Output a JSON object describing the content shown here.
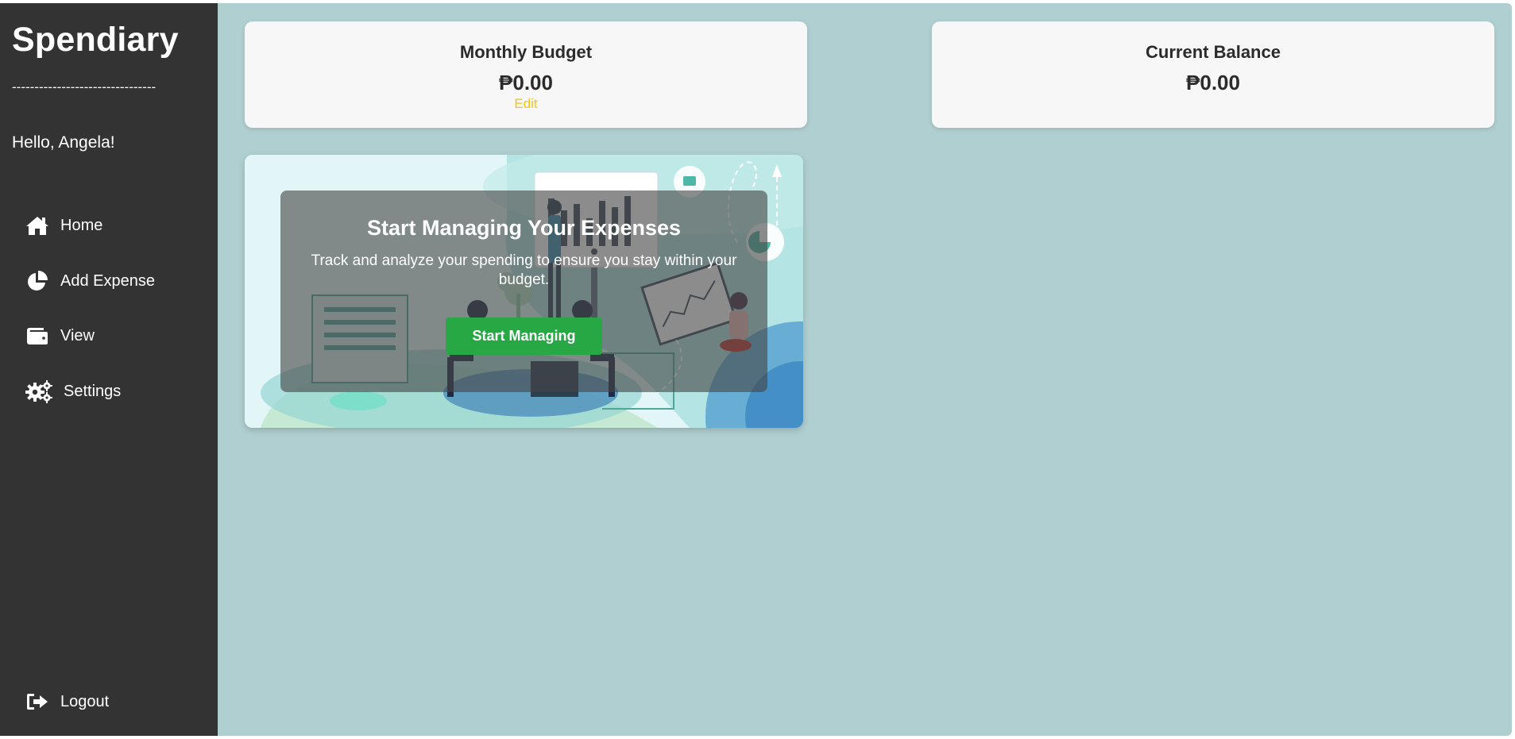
{
  "app": {
    "brand": "Spendiary",
    "divider": "--------------------------------",
    "greeting": "Hello, Angela!"
  },
  "sidebar": {
    "items": [
      {
        "label": "Home",
        "icon": "home-icon"
      },
      {
        "label": "Add Expense",
        "icon": "pie-chart-icon"
      },
      {
        "label": "View",
        "icon": "wallet-icon"
      },
      {
        "label": "Settings",
        "icon": "gears-icon"
      }
    ],
    "logout": {
      "label": "Logout",
      "icon": "sign-out-icon"
    }
  },
  "budget": {
    "title": "Monthly Budget",
    "value": "₱0.00",
    "edit_label": "Edit"
  },
  "balance": {
    "title": "Current Balance",
    "value": "₱0.00"
  },
  "hero": {
    "title": "Start Managing Your Expenses",
    "text": "Track and analyze your spending to ensure you stay within your budget.",
    "button_label": "Start Managing"
  },
  "colors": {
    "sidebar_bg": "#333333",
    "main_bg": "#b0cfd0",
    "card_bg": "#f7f7f7",
    "edit_link": "#f2c518",
    "primary_button": "#28a745"
  }
}
